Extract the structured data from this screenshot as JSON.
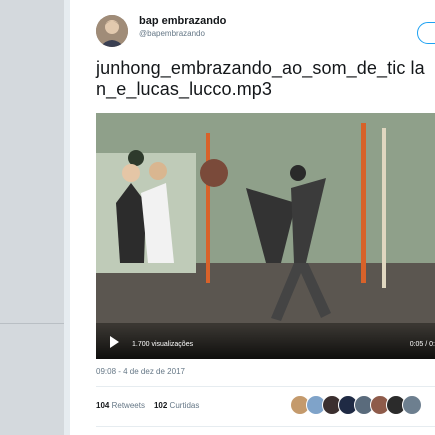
{
  "tweet": {
    "display_name": "bap embrazando",
    "handle": "@bapembrazando",
    "text": "junhong_embrazando_ao_som_de_tic lan_e_lucas_lucco.mp3",
    "timestamp": "09:08 - 4 de dez de 2017"
  },
  "video": {
    "views": "1.700 visualizações",
    "duration": "0:05 / 0:"
  },
  "stats": {
    "retweets_count": "104",
    "retweets_label": "Retweets",
    "likes_count": "102",
    "likes_label": "Curtidas"
  },
  "likers": [
    {
      "color": "#c49a6c"
    },
    {
      "color": "#7fa3c9"
    },
    {
      "color": "#3b2f2f"
    },
    {
      "color": "#1f2a44"
    },
    {
      "color": "#5a6b7c"
    },
    {
      "color": "#8e5b4a"
    },
    {
      "color": "#2b2b2b"
    },
    {
      "color": "#6d7f8f"
    }
  ],
  "colors": {
    "accent": "#1da1f2",
    "text": "#14171a",
    "muted": "#657786"
  }
}
